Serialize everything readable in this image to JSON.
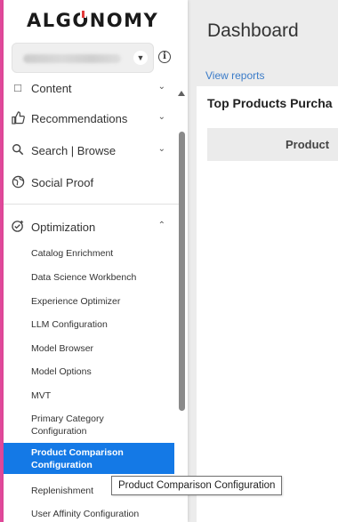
{
  "brand": {
    "logo_text_left": "ALG",
    "logo_text_o": "O",
    "logo_text_right": "NOMY",
    "accent_color": "#e0489a"
  },
  "site_selector": {
    "value": "",
    "chevron": "chevron-down-icon"
  },
  "sidebar": {
    "sections": [
      {
        "label": "Content",
        "icon": "content-icon",
        "expanded": false
      },
      {
        "label": "Recommendations",
        "icon": "thumbs-up-icon",
        "expanded": false
      },
      {
        "label": "Search | Browse",
        "icon": "search-icon",
        "expanded": false
      },
      {
        "label": "Social Proof",
        "icon": "globe-icon"
      },
      {
        "label": "Optimization",
        "icon": "optimization-icon",
        "expanded": true
      }
    ],
    "optimization_items": [
      "Catalog Enrichment",
      "Data Science Workbench",
      "Experience Optimizer",
      "LLM Configuration",
      "Model Browser",
      "Model Options",
      "MVT",
      "Primary Category\nConfiguration",
      "Product Comparison\nConfiguration",
      "Replenishment",
      "User Affinity Configuration"
    ],
    "active_item": "Product Comparison Configuration",
    "active_color": "#1479e6"
  },
  "main": {
    "title": "Dashboard",
    "view_reports": "View reports",
    "panel_title": "Top Products Purcha",
    "table_header": "Product"
  },
  "tooltip": {
    "text": "Product Comparison Configuration"
  }
}
